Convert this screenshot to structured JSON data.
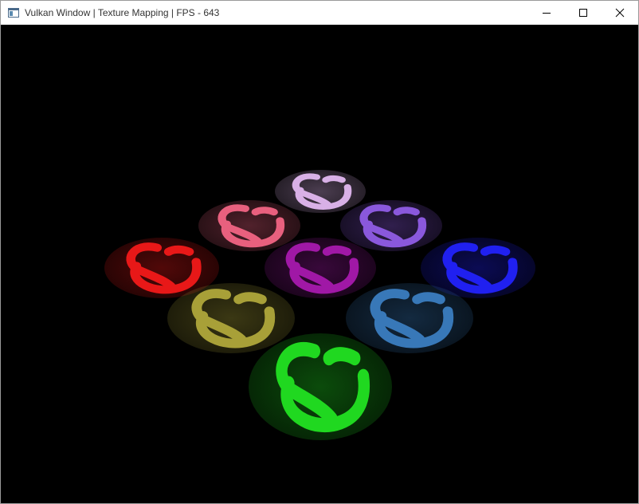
{
  "window": {
    "title": "Vulkan Window | Texture Mapping | FPS - 643",
    "icon": "app-window-icon",
    "controls": [
      "minimize-icon",
      "maximize-icon",
      "close-icon"
    ]
  },
  "scene": {
    "background": "#000000",
    "quads": [
      {
        "id": "top-lilac",
        "color": "#d8b0e6"
      },
      {
        "id": "pink",
        "color": "#e8607e"
      },
      {
        "id": "violet",
        "color": "#8a58dc"
      },
      {
        "id": "red",
        "color": "#e81818"
      },
      {
        "id": "magenta",
        "color": "#a018a6"
      },
      {
        "id": "blue",
        "color": "#2020f0"
      },
      {
        "id": "olive",
        "color": "#a8a038"
      },
      {
        "id": "teal",
        "color": "#3878b8"
      },
      {
        "id": "green",
        "color": "#20d820"
      }
    ]
  }
}
